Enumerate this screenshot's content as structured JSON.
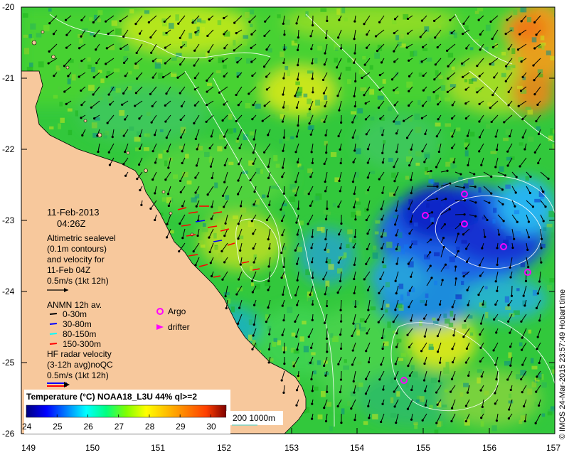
{
  "map": {
    "date": "11-Feb-2013",
    "time": "04:26Z",
    "lat_ticks": [
      "-20",
      "-21",
      "-22",
      "-23",
      "-24",
      "-25",
      "-26"
    ],
    "lon_ticks": [
      "149",
      "150",
      "151",
      "152",
      "153",
      "154",
      "155",
      "156",
      "157"
    ],
    "lat_range": [
      -26,
      -20
    ],
    "lon_range": [
      149,
      157
    ],
    "land_color": "#f7c89c",
    "contour_color": "#ffffff",
    "vector_color": "#000000"
  },
  "legend": {
    "alt_line1": "Altimetric sealevel",
    "alt_line2": "(0.1m contours)",
    "alt_line3": "and velocity for",
    "alt_line4": "11-Feb 04Z",
    "alt_scale": "0.5m/s (1kt 12h)",
    "anmn_title": "ANMN 12h av.",
    "anmn_items": [
      {
        "label": "0-30m",
        "color": "#000000"
      },
      {
        "label": "30-80m",
        "color": "#0000ff"
      },
      {
        "label": "80-150m",
        "color": "#00ffff"
      },
      {
        "label": "150-300m",
        "color": "#ff0000"
      }
    ],
    "argo_label": "Argo",
    "drifter_label": "drifter",
    "argo_color": "#ff00ff",
    "hf_line1": "HF radar velocity",
    "hf_line2": "(3-12h avg)noQC",
    "hf_scale": "0.5m/s (1kt 12h)"
  },
  "colorbar": {
    "title": "Temperature (°C) NOAA18_L3U 44% ql>=2",
    "ticks": [
      "24",
      "25",
      "26",
      "27",
      "28",
      "29",
      "30"
    ],
    "range": [
      24,
      30.5
    ],
    "colors": [
      "#00007f",
      "#0000ff",
      "#007fff",
      "#00ffff",
      "#00ff7f",
      "#7fff00",
      "#ffff00",
      "#ffbf00",
      "#ff7f00",
      "#ff3f00",
      "#7f0000"
    ]
  },
  "depth_legend": {
    "label": "200 1000m",
    "color": "#7fd4c4"
  },
  "credit": "© IMOS 24-Mar-2015 23:57:49 Hobart time"
}
